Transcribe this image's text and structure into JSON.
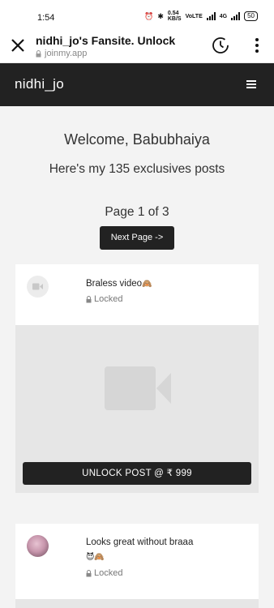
{
  "status_bar": {
    "time": "1:54",
    "speed_value": "0.54",
    "speed_unit": "KB/S",
    "volte": "VoLTE",
    "network": "4G",
    "battery": "50"
  },
  "browser": {
    "title": "nidhi_jo's Fansite. Unlock",
    "url": "joinmy.app"
  },
  "navbar": {
    "brand": "nidhi_jo"
  },
  "main": {
    "welcome": "Welcome, Babubhaiya",
    "subtitle": "Here's my 135 exclusives posts",
    "page_indicator": "Page 1 of 3",
    "next_button": "Next Page ->"
  },
  "posts": [
    {
      "title": "Braless video",
      "title_emoji": "🙈",
      "lock_label": "Locked",
      "unlock_button": "UNLOCK POST @ ₹ 999"
    },
    {
      "title": "Looks great without braaa",
      "title_emoji": "😈🙈",
      "lock_label": "Locked"
    }
  ],
  "colors": {
    "navbar_bg": "#222222",
    "page_bg": "#f3f3f3",
    "media_placeholder": "#e6e6e6",
    "button_bg": "#222222"
  },
  "icons": [
    "close-icon",
    "lock-icon",
    "timer-icon",
    "kebab-menu-icon",
    "hamburger-icon",
    "video-camera-icon"
  ]
}
